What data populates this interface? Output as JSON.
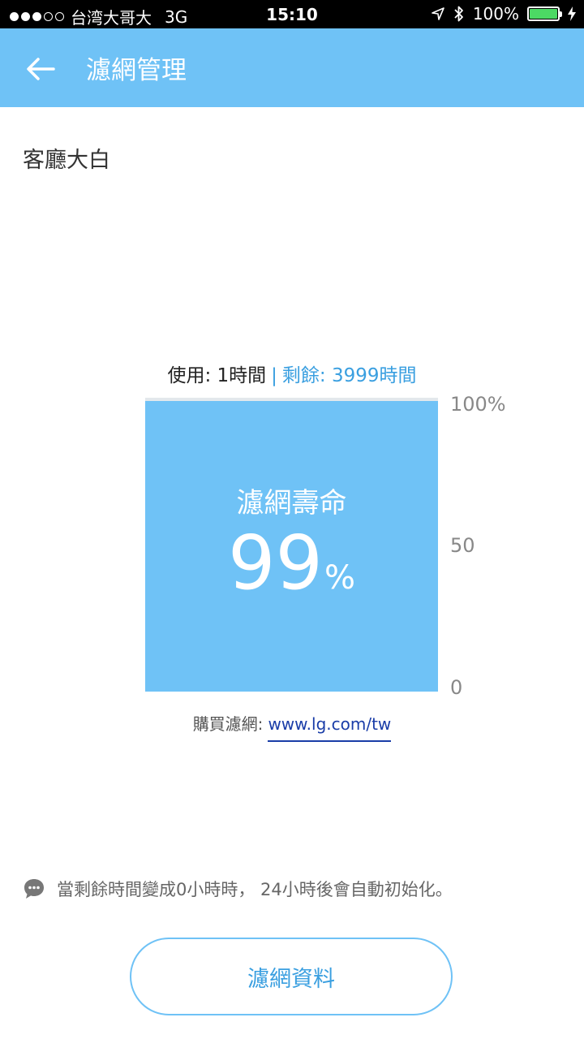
{
  "status_bar": {
    "carrier": "台湾大哥大",
    "network": "3G",
    "time": "15:10",
    "battery_percent": "100%",
    "battery_level": 1.0,
    "icons": [
      "location-arrow-icon",
      "bluetooth-icon",
      "battery-icon",
      "charging-bolt-icon"
    ]
  },
  "header": {
    "title": "濾網管理",
    "back_icon": "back-arrow-icon"
  },
  "device": {
    "name": "客廳大白"
  },
  "usage": {
    "used": "使用: 1時間",
    "separator": "|",
    "remaining": "剩餘: 3999時間"
  },
  "gauge": {
    "label": "濾網壽命",
    "value": "99",
    "unit": "%",
    "level_percent": 99,
    "ticks": [
      "100%",
      "50",
      "0"
    ]
  },
  "buy": {
    "label": "購買濾網:",
    "link": "www.lg.com/tw"
  },
  "notice": {
    "text": "當剩餘時間變成0小時時， 24小時後會自動初始化。",
    "icon": "chat-bubble-icon"
  },
  "actions": {
    "filter_info": "濾網資料"
  },
  "colors": {
    "accent": "#6fc2f6",
    "link_blue": "#3a9fe0",
    "link_dark": "#1a3da8"
  }
}
